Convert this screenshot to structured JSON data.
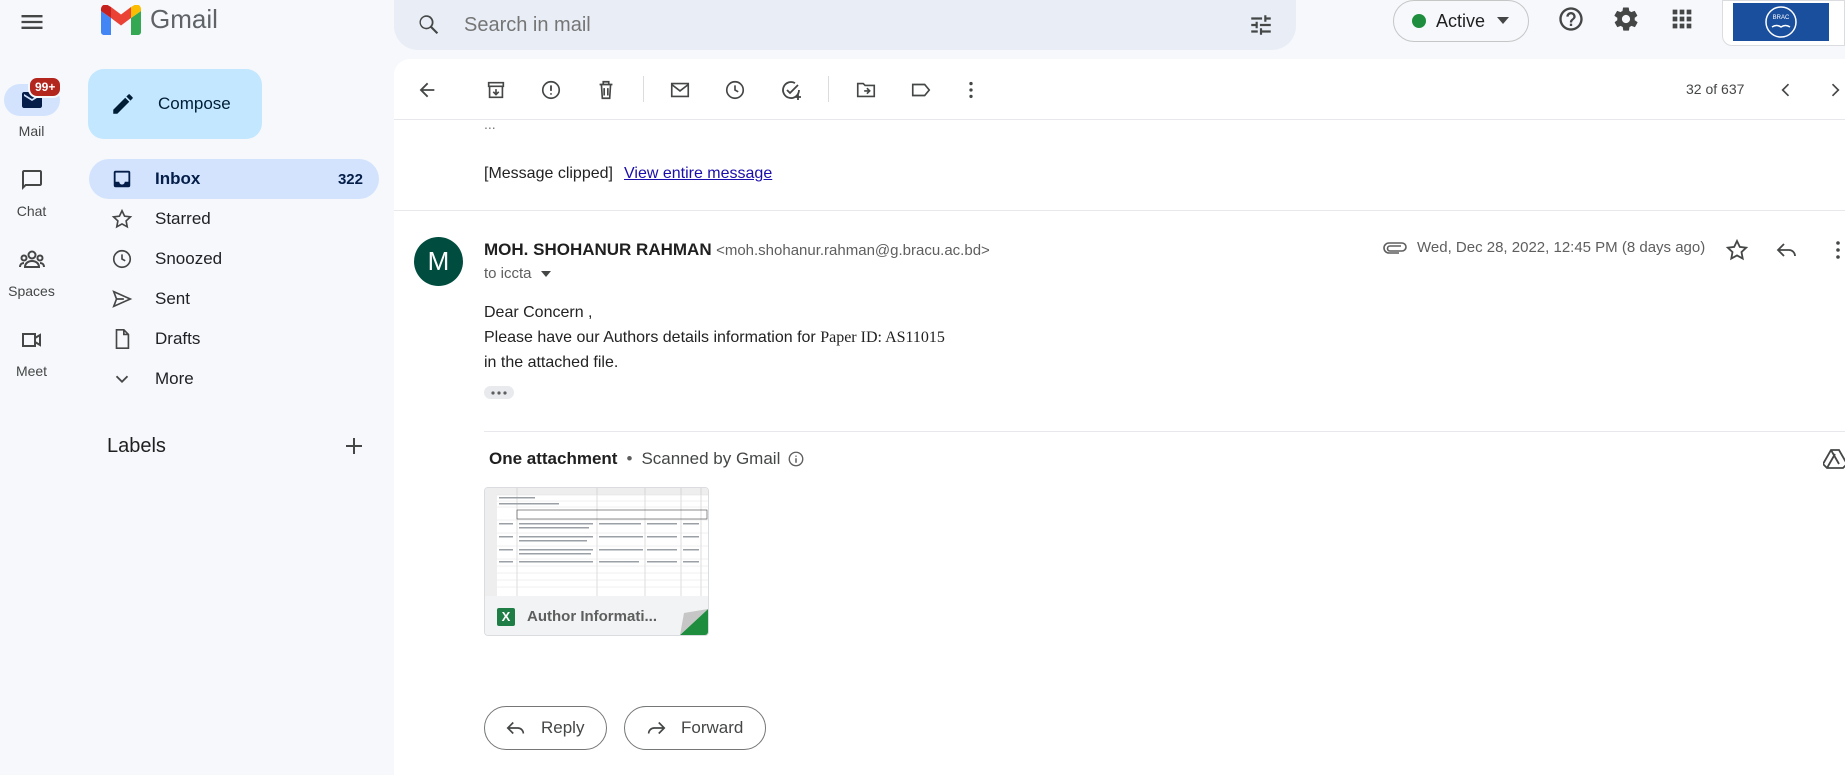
{
  "app": {
    "name": "Gmail"
  },
  "rail": {
    "mail_badge": "99+",
    "items": [
      {
        "label": "Mail"
      },
      {
        "label": "Chat"
      },
      {
        "label": "Spaces"
      },
      {
        "label": "Meet"
      }
    ]
  },
  "search": {
    "placeholder": "Search in mail"
  },
  "header": {
    "status": "Active"
  },
  "sidebar": {
    "compose": "Compose",
    "items": [
      {
        "label": "Inbox",
        "count": "322"
      },
      {
        "label": "Starred"
      },
      {
        "label": "Snoozed"
      },
      {
        "label": "Sent"
      },
      {
        "label": "Drafts"
      },
      {
        "label": "More"
      }
    ],
    "labels_title": "Labels"
  },
  "toolbar": {
    "pagination": "32 of 637"
  },
  "prev_message": {
    "ellipsis": "...",
    "clipped": "[Message clipped]",
    "view_link": "View entire message"
  },
  "message": {
    "avatar_letter": "M",
    "sender_name": "MOH. SHOHANUR RAHMAN",
    "sender_email": "<moh.shohanur.rahman@g.bracu.ac.bd>",
    "to": "to iccta",
    "date": "Wed, Dec 28, 2022, 12:45 PM (8 days ago)",
    "body_line1": "Dear Concern ,",
    "body_line2_a": "Please have our Authors details information for ",
    "body_line2_b": "Paper ID: AS11015",
    "body_line3": "in the attached file."
  },
  "attachments": {
    "title": "One attachment",
    "scanned": "Scanned by Gmail",
    "file_name": "Author Informati...",
    "file_icon_letter": "X"
  },
  "actions": {
    "reply": "Reply",
    "forward": "Forward"
  },
  "colors": {
    "accent": "#0b57d0",
    "avatar": "#004d40",
    "active_dot": "#1e8e3e",
    "excel": "#1e7e45"
  }
}
